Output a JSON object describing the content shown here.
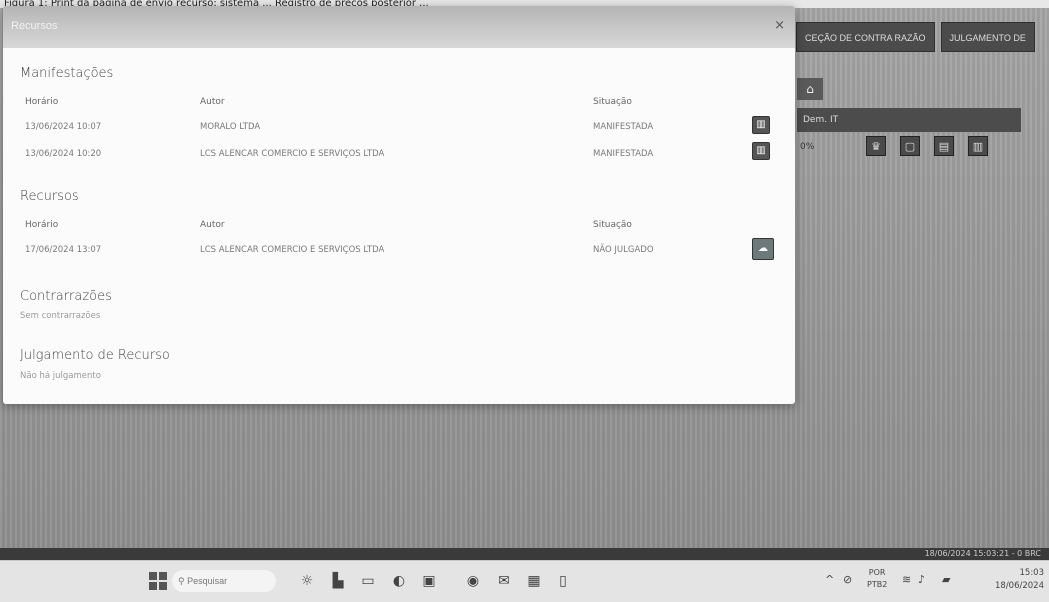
{
  "background": {
    "caption_fragment": "Figura 1: Print da página de envio recurso: sistema ... Registro de preços posterior ...",
    "top_actions": [
      "CEÇÃO DE CONTRA RAZÃO",
      "JULGAMENTO DE"
    ],
    "home_icon": "home-icon",
    "bar_label": "Dem. IT",
    "pct_label": "0%",
    "row_icons": [
      "award-icon",
      "chat-icon",
      "doc-icon",
      "book-icon"
    ],
    "status_text": "18/06/2024 15:03:21 - 0 BRC"
  },
  "modal": {
    "title": "Recursos",
    "close_label": "×",
    "manifestacoes": {
      "title": "Manifestações",
      "headers": {
        "horario": "Horário",
        "autor": "Autor",
        "situacao": "Situação"
      },
      "rows": [
        {
          "horario": "13/06/2024 10:07",
          "autor": "MORALO LTDA",
          "situacao": "MANIFESTADA",
          "action_icon": "book-icon"
        },
        {
          "horario": "13/06/2024 10:20",
          "autor": "LCS ALENCAR COMERCIO E SERVIÇOS LTDA",
          "situacao": "MANIFESTADA",
          "action_icon": "book-icon"
        }
      ]
    },
    "recursos": {
      "title": "Recursos",
      "headers": {
        "horario": "Horário",
        "autor": "Autor",
        "situacao": "Situação"
      },
      "rows": [
        {
          "horario": "17/06/2024 13:07",
          "autor": "LCS ALENCAR COMERCIO E SERVIÇOS LTDA",
          "situacao": "NÃO JULGADO",
          "action_icon": "cloud-icon"
        }
      ]
    },
    "contrarrazoes": {
      "title": "Contrarrazões",
      "note": "Sem contrarrazões"
    },
    "julgamento": {
      "title": "Julgamento de Recurso",
      "note": "Não há julgamento"
    }
  },
  "taskbar": {
    "search_placeholder": "Pesquisar",
    "apps": [
      "widgets-icon",
      "files-icon",
      "folder-icon",
      "edge-icon",
      "store-icon",
      "chrome-icon",
      "mail-icon",
      "excel-icon",
      "doc-icon"
    ],
    "lang_top": "POR",
    "lang_bottom": "PTB2",
    "time": "15:03",
    "date": "18/06/2024"
  }
}
